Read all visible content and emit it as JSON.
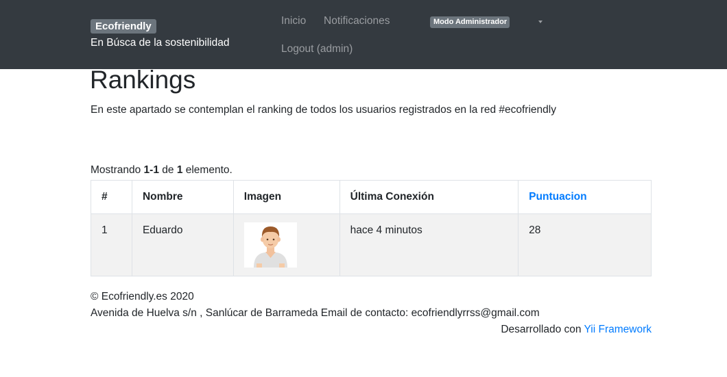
{
  "navbar": {
    "brand": "Ecofriendly",
    "tagline": "En Búsca de la sostenibilidad",
    "links": {
      "home": "Inicio",
      "notifications": "Notificaciones",
      "logout": "Logout (admin)"
    },
    "admin_badge": "Modo Administrador"
  },
  "page": {
    "title": "Rankings",
    "description": "En este apartado se contemplan el ranking de todos los usuarios registrados en la red #ecofriendly"
  },
  "summary": {
    "prefix": "Mostrando ",
    "range": "1-1",
    "middle": " de ",
    "total": "1",
    "suffix": " elemento."
  },
  "table": {
    "columns": [
      "#",
      "Nombre",
      "Imagen",
      "Última Conexión",
      "Puntuacion"
    ],
    "rows": [
      {
        "index": "1",
        "name": "Eduardo",
        "image": "male-avatar",
        "last_connection": "hace 4 minutos",
        "score": "28"
      }
    ]
  },
  "footer": {
    "copyright": "© Ecofriendly.es 2020",
    "address": "Avenida de Huelva s/n , Sanlúcar de Barrameda Email de contacto: ecofriendlyrrss@gmail.com",
    "developed_prefix": "Desarrollado con ",
    "framework_link": "Yii Framework"
  },
  "colors": {
    "navbar_bg": "#343a40",
    "badge_bg": "#6c757d",
    "link": "#007bff",
    "row_stripe": "#f2f2f2"
  }
}
